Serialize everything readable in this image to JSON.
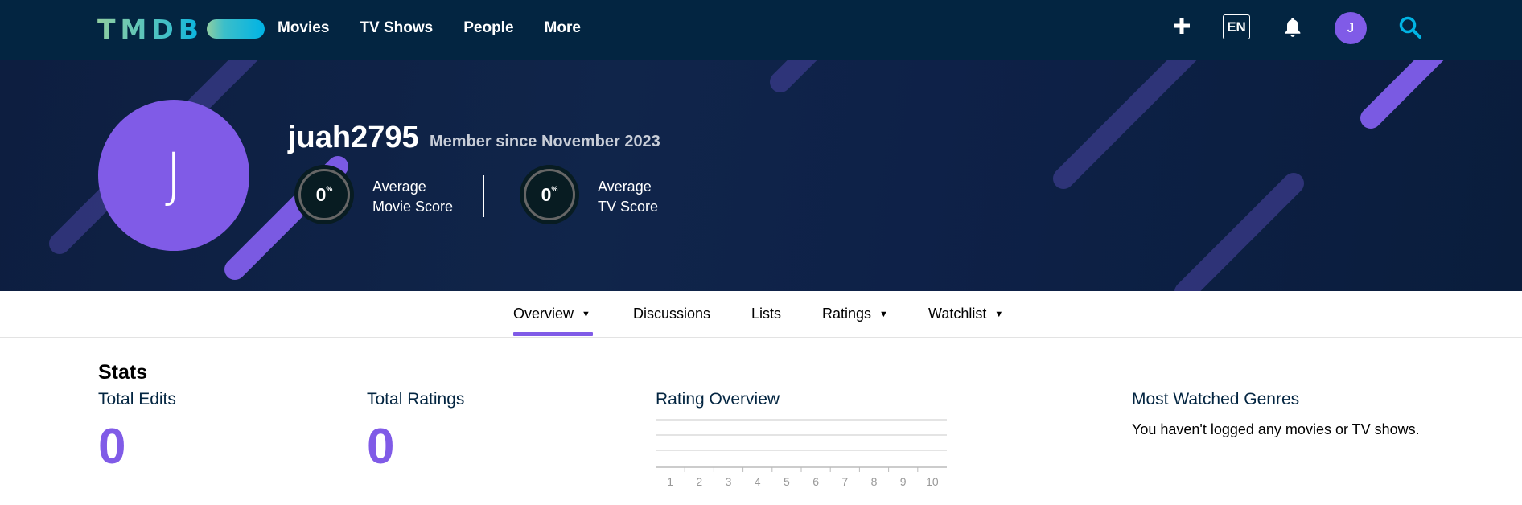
{
  "nav": {
    "logo_text": "TMDB",
    "menu": [
      "Movies",
      "TV Shows",
      "People",
      "More"
    ],
    "language": "EN",
    "avatar_initial": "J",
    "icons": [
      "plus-icon",
      "bell-icon",
      "search-icon"
    ]
  },
  "profile": {
    "initial": "J",
    "username": "juah2795",
    "member_since": "Member since November 2023",
    "movie_score": {
      "value": "0",
      "unit": "%",
      "label_line1": "Average",
      "label_line2": "Movie Score"
    },
    "tv_score": {
      "value": "0",
      "unit": "%",
      "label_line1": "Average",
      "label_line2": "TV Score"
    }
  },
  "tabs": [
    {
      "label": "Overview",
      "dropdown": true,
      "active": true
    },
    {
      "label": "Discussions",
      "dropdown": false
    },
    {
      "label": "Lists",
      "dropdown": false
    },
    {
      "label": "Ratings",
      "dropdown": true
    },
    {
      "label": "Watchlist",
      "dropdown": true
    }
  ],
  "stats": {
    "title": "Stats",
    "total_edits_label": "Total Edits",
    "total_edits": "0",
    "total_ratings_label": "Total Ratings",
    "total_ratings": "0",
    "rating_overview_label": "Rating Overview",
    "genres_label": "Most Watched Genres",
    "genres_empty": "You haven't logged any movies or TV shows."
  },
  "chart_data": {
    "type": "bar",
    "categories": [
      "1",
      "2",
      "3",
      "4",
      "5",
      "6",
      "7",
      "8",
      "9",
      "10"
    ],
    "values": [
      0,
      0,
      0,
      0,
      0,
      0,
      0,
      0,
      0,
      0
    ],
    "title": "Rating Overview",
    "grid": true
  },
  "colors": {
    "nav_bg": "#032541",
    "accent_purple": "#805be7",
    "logo_green": "#90cea1",
    "logo_blue": "#01b4e4"
  }
}
